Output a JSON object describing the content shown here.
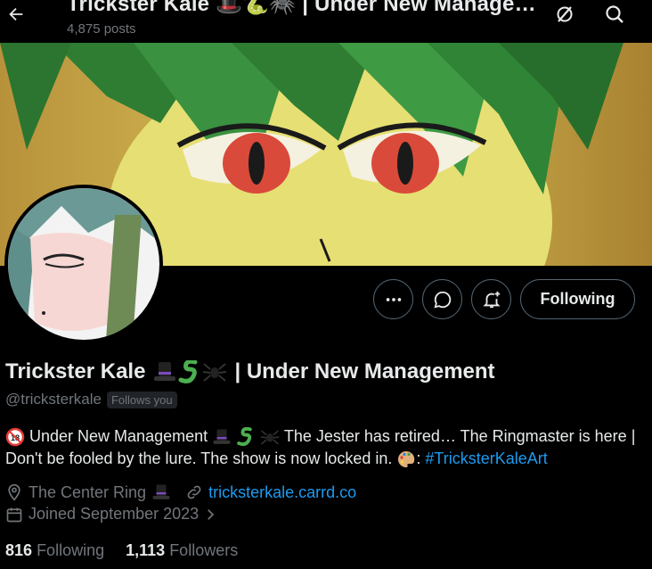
{
  "header": {
    "title": "Trickster Kale 🎩🐍🕷️ | Under New Management",
    "post_count": "4,875 posts"
  },
  "profile": {
    "name_text": "Trickster Kale",
    "name_suffix": "| Under New Management",
    "handle": "@tricksterkale",
    "follows_you": "Follows you",
    "bio": {
      "part1": "Under New Management",
      "part2": "The Jester has retired… The Ringmaster is here | Don't be fooled by the lure. The show is now locked in.",
      "part3": ":",
      "hashtag": "#TricksterKaleArt"
    },
    "location": "The Center Ring",
    "website": "tricksterkale.carrd.co",
    "joined": "Joined September 2023",
    "following_count": "816",
    "following_label": "Following",
    "followers_count": "1,113",
    "followers_label": "Followers"
  },
  "buttons": {
    "following": "Following"
  },
  "icons": {
    "back": "arrow-left-icon",
    "no_translate": "sync-off-icon",
    "search": "search-icon",
    "more": "more-icon",
    "message": "message-icon",
    "notify": "bell-plus-icon",
    "location": "location-pin-icon",
    "link": "link-icon",
    "calendar": "calendar-icon"
  },
  "colors": {
    "accent": "#1d9bf0",
    "muted": "#71767b",
    "text": "#e7e9ea",
    "border": "#536471"
  }
}
